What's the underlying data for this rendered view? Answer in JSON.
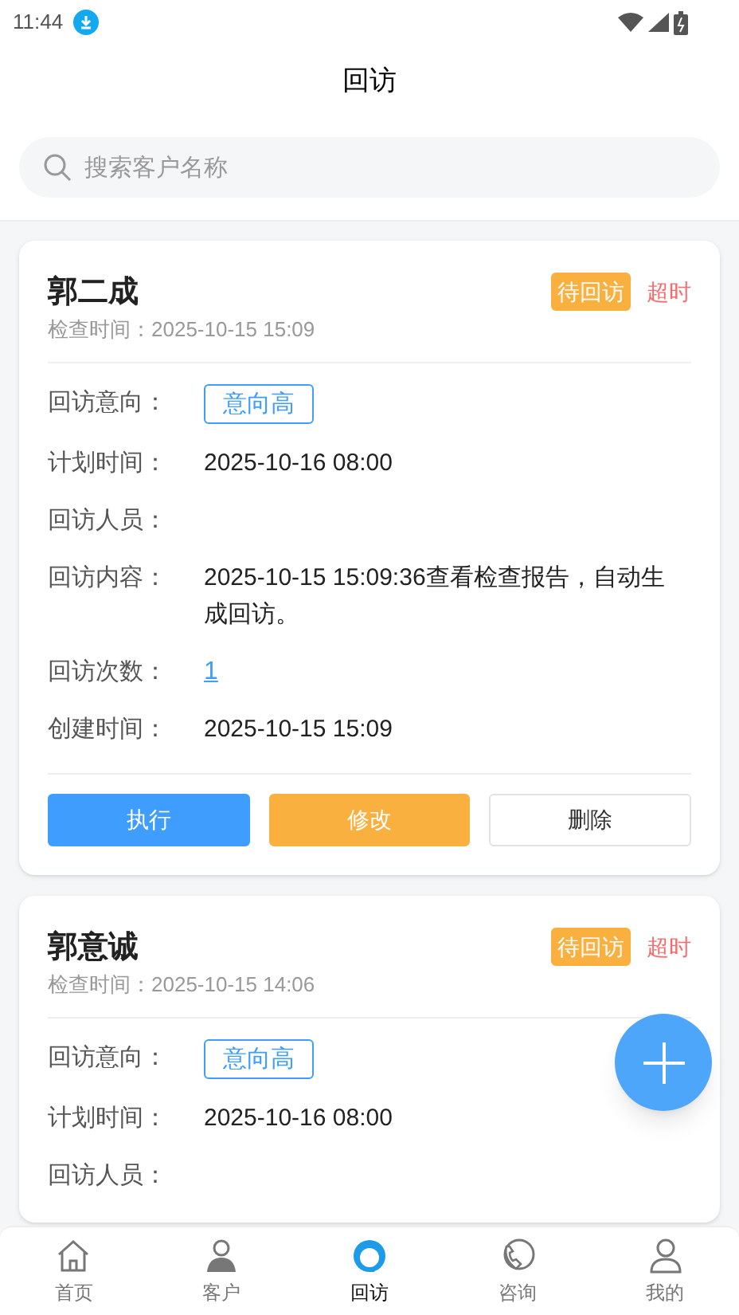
{
  "status_bar": {
    "time": "11:44"
  },
  "header": {
    "title": "回访"
  },
  "search": {
    "placeholder": "搜索客户名称"
  },
  "cards": [
    {
      "name": "郭二成",
      "status": "待回访",
      "overdue": "超时",
      "check_time": "检查时间：2025-10-15 15:09",
      "fields": [
        {
          "kind": "tag",
          "label": "回访意向：",
          "value": "意向高"
        },
        {
          "kind": "text",
          "label": "计划时间：",
          "value": "2025-10-16 08:00"
        },
        {
          "kind": "blank",
          "label": "回访人员："
        },
        {
          "kind": "text",
          "label": "回访内容：",
          "value": "2025-10-15 15:09:36查看检查报告，自动生成回访。"
        },
        {
          "kind": "link",
          "label": "回访次数：",
          "value": "1"
        },
        {
          "kind": "text",
          "label": "创建时间：",
          "value": "2025-10-15 15:09"
        }
      ],
      "buttons": [
        {
          "kind": "primary",
          "label": "执行"
        },
        {
          "kind": "warning",
          "label": "修改"
        },
        {
          "kind": "plain",
          "label": "删除"
        }
      ]
    },
    {
      "name": "郭意诚",
      "status": "待回访",
      "overdue": "超时",
      "check_time": "检查时间：2025-10-15 14:06",
      "fields": [
        {
          "kind": "tag",
          "label": "回访意向：",
          "value": "意向高"
        },
        {
          "kind": "text",
          "label": "计划时间：",
          "value": "2025-10-16 08:00"
        },
        {
          "kind": "blank",
          "label": "回访人员："
        }
      ]
    }
  ],
  "tab_bar": [
    {
      "label": "首页",
      "selected": false
    },
    {
      "label": "客户",
      "selected": false
    },
    {
      "label": "回访",
      "selected": true
    },
    {
      "label": "咨询",
      "selected": false
    },
    {
      "label": "我的",
      "selected": false
    }
  ]
}
